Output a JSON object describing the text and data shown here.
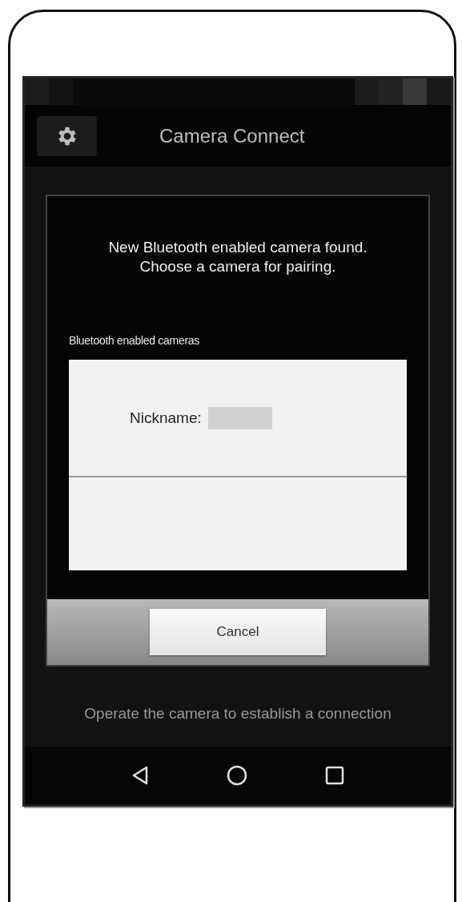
{
  "app_bar": {
    "title": "Camera Connect"
  },
  "dialog": {
    "message": "New Bluetooth enabled camera found.\nChoose a camera for pairing.",
    "list_label": "Bluetooth enabled cameras",
    "cameras": [
      {
        "label": "Nickname:",
        "value_hidden": true
      },
      {
        "value_hidden": false
      }
    ],
    "buttons": [
      {
        "label": "Cancel"
      }
    ]
  },
  "hint": "Operate the camera to establish a connection"
}
